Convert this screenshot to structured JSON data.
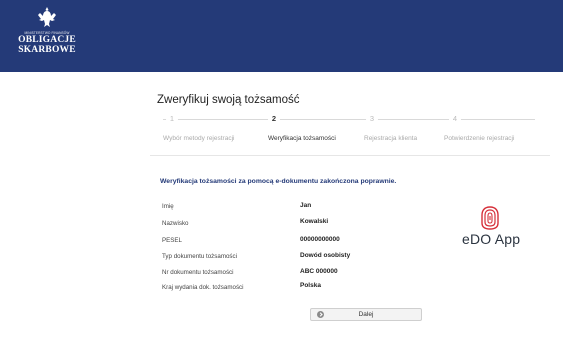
{
  "header": {
    "ministry": "MINISTERSTWO FINANSÓW",
    "brand_line1": "OBLIGACJE",
    "brand_line2": "SKARBOWE",
    "bg_color": "#243a78"
  },
  "page": {
    "title": "Zweryfikuj swoją tożsamość"
  },
  "steps": [
    {
      "number": "1",
      "label": "Wybór metody rejestracji",
      "active": false
    },
    {
      "number": "2",
      "label": "Weryfikacja tożsamości",
      "active": true
    },
    {
      "number": "3",
      "label": "Rejestracja klienta",
      "active": false
    },
    {
      "number": "4",
      "label": "Potwierdzenie rejestracji",
      "active": false
    }
  ],
  "success_message": "Weryfikacja tożsamości za pomocą e-dokumentu zakończona poprawnie.",
  "details": [
    {
      "label": "Imię",
      "value": "Jan"
    },
    {
      "label": "Nazwisko",
      "value": "Kowalski"
    },
    {
      "label": "PESEL",
      "value": "00000000000"
    },
    {
      "label": "Typ dokumentu tożsamości",
      "value": "Dowód osobisty"
    },
    {
      "label": "Nr dokumentu tożsamości",
      "value": "ABC 000000"
    },
    {
      "label": "Kraj wydania dok. tożsamości",
      "value": "Polska"
    }
  ],
  "edo_app": {
    "name": "eDO App",
    "color": "#d6303a"
  },
  "next_button": {
    "label": "Dalej",
    "icon": "chevron-right-icon"
  }
}
